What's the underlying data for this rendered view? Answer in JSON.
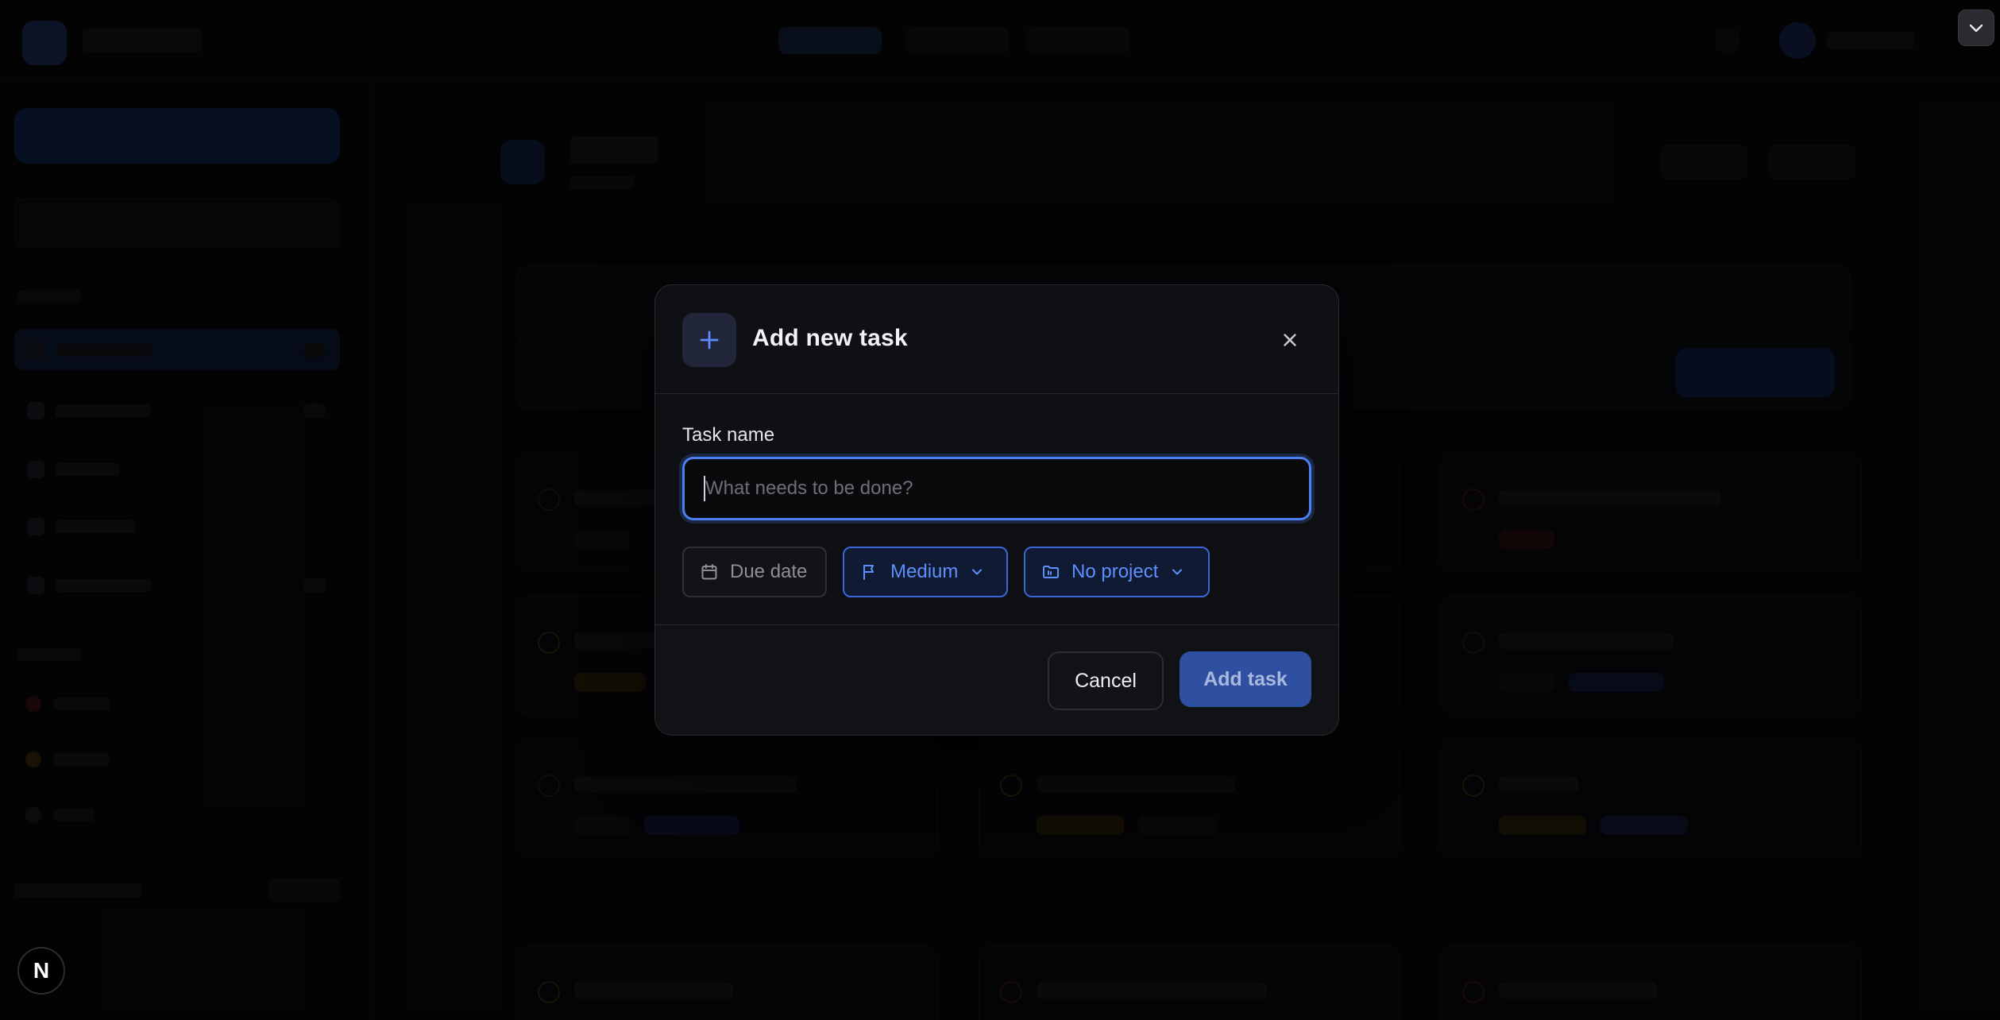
{
  "modal": {
    "title": "Add new task",
    "field_label": "Task name",
    "input_value": "",
    "input_placeholder": "What needs to be done?",
    "chips": {
      "due_date": "Due date",
      "priority": "Medium",
      "project": "No project"
    },
    "buttons": {
      "cancel": "Cancel",
      "add": "Add task"
    }
  },
  "badge": {
    "letter": "N"
  },
  "icons": {
    "header": "plus-icon",
    "close": "close-icon",
    "due_date": "calendar-icon",
    "priority": "flag-icon",
    "project": "folder-icon",
    "dropdown": "chevron-down-icon",
    "corner_toggle": "chevron-down-icon"
  },
  "colors": {
    "accent": "#4c7ff2",
    "accent_text": "#5d90ff",
    "add_button": "#2f4fa0",
    "modal_bg": "#0f1013"
  }
}
